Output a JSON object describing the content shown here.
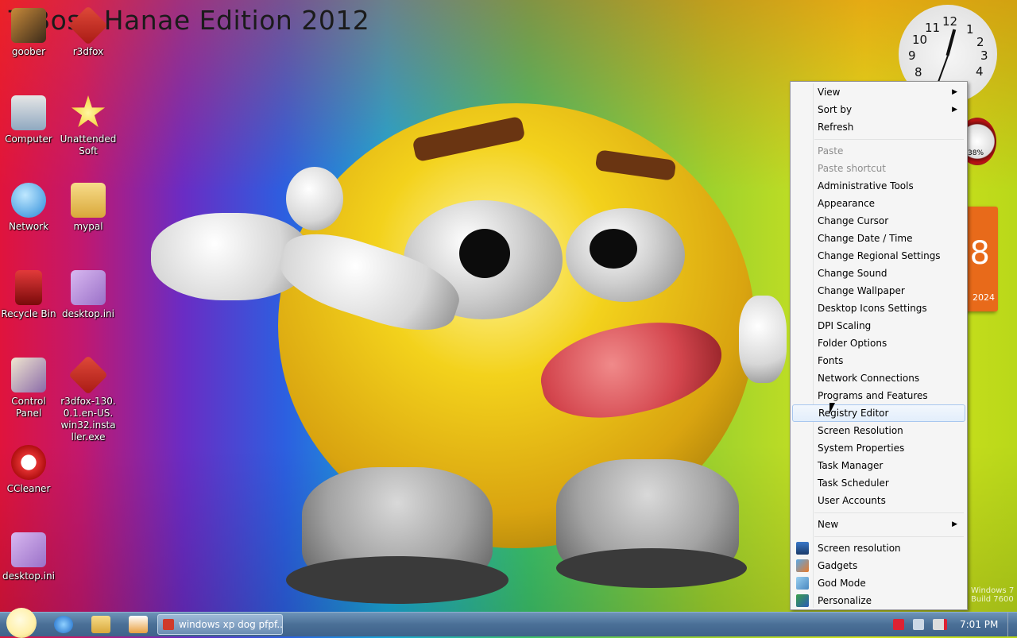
{
  "desktop": {
    "title_text": "7 Boss Hanae Edition 2012",
    "icons": [
      {
        "label": "goober"
      },
      {
        "label": "r3dfox"
      },
      {
        "label": "Computer"
      },
      {
        "label": "Unattended Soft"
      },
      {
        "label": "Network"
      },
      {
        "label": "mypal"
      },
      {
        "label": "Recycle Bin"
      },
      {
        "label": "desktop.ini"
      },
      {
        "label": "Control Panel"
      },
      {
        "label": "r3dfox-130.0.1.en-US.win32.installer.exe"
      },
      {
        "label": "CCleaner"
      },
      {
        "label": "desktop.ini"
      }
    ]
  },
  "gadgets": {
    "clock_numbers": [
      "12",
      "1",
      "2",
      "3",
      "4",
      "9",
      "10",
      "11",
      "8"
    ],
    "meter_label": "38%",
    "calendar_day": "8",
    "calendar_year": "2024",
    "watermark_line1": "Windows 7",
    "watermark_line2": "Build 7600"
  },
  "context_menu": {
    "items": [
      {
        "label": "View",
        "submenu": true
      },
      {
        "label": "Sort by",
        "submenu": true
      },
      {
        "label": "Refresh"
      },
      {
        "label": "Paste",
        "disabled": true
      },
      {
        "label": "Paste shortcut",
        "disabled": true
      },
      {
        "label": "Administrative Tools"
      },
      {
        "label": "Appearance"
      },
      {
        "label": "Change Cursor"
      },
      {
        "label": "Change Date / Time"
      },
      {
        "label": "Change Regional Settings"
      },
      {
        "label": "Change Sound"
      },
      {
        "label": "Change Wallpaper"
      },
      {
        "label": "Desktop Icons Settings"
      },
      {
        "label": "DPI Scaling"
      },
      {
        "label": "Folder Options"
      },
      {
        "label": "Fonts"
      },
      {
        "label": "Network Connections"
      },
      {
        "label": "Programs and Features"
      },
      {
        "label": "Registry Editor",
        "highlighted": true
      },
      {
        "label": "Screen Resolution"
      },
      {
        "label": "System Properties"
      },
      {
        "label": "Task Manager"
      },
      {
        "label": "Task Scheduler"
      },
      {
        "label": "User Accounts"
      },
      {
        "label": "New",
        "submenu": true
      },
      {
        "label": "Screen resolution",
        "icon": "monitor-icon"
      },
      {
        "label": "Gadgets",
        "icon": "gadgets-icon"
      },
      {
        "label": "God Mode",
        "icon": "control-panel-icon"
      },
      {
        "label": "Personalize",
        "icon": "personalize-icon"
      }
    ]
  },
  "taskbar": {
    "task_button_label": "windows xp dog pfpf...",
    "time": "7:01 PM"
  },
  "colors": {
    "menu_bg": "#f5f5f5",
    "menu_hover_border": "#a8c7ef",
    "taskbar": "#4a6f96"
  }
}
